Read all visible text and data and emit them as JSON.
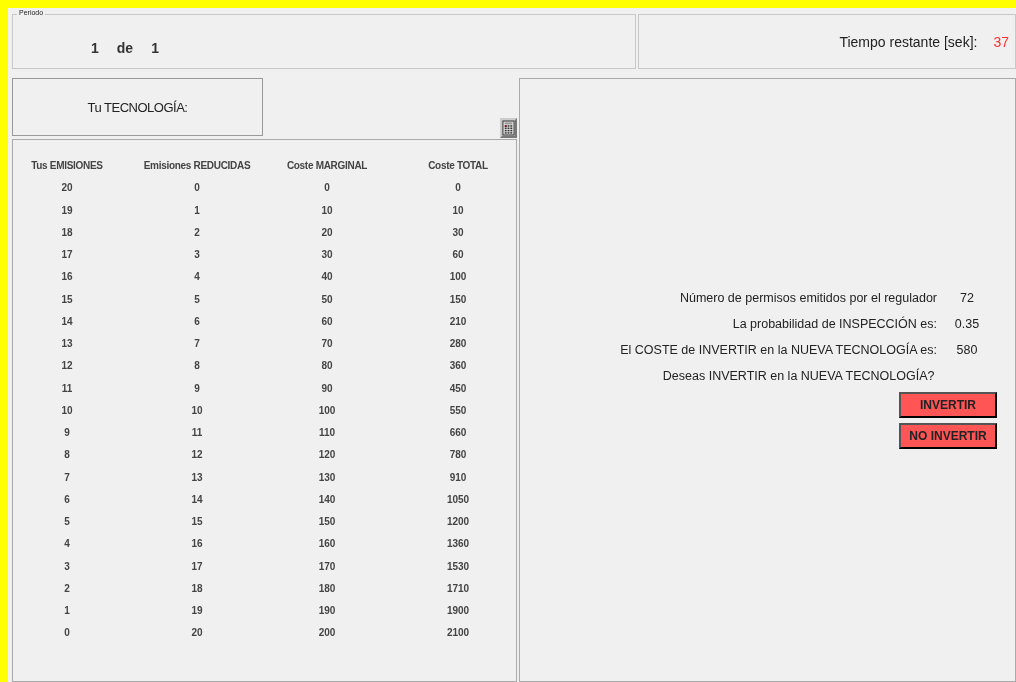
{
  "period": {
    "legend": "Periodo",
    "current": "1",
    "separator": "de",
    "total": "1"
  },
  "timer": {
    "label": "Tiempo restante [sek]:",
    "value": "37"
  },
  "technology": {
    "label": "Tu TECNOLOGÍA:"
  },
  "table": {
    "columns": [
      "Tus EMISIONES",
      "Emisiones REDUCIDAS",
      "Coste MARGINAL",
      "Coste TOTAL"
    ],
    "rows": [
      [
        "20",
        "0",
        "0",
        "0"
      ],
      [
        "19",
        "1",
        "10",
        "10"
      ],
      [
        "18",
        "2",
        "20",
        "30"
      ],
      [
        "17",
        "3",
        "30",
        "60"
      ],
      [
        "16",
        "4",
        "40",
        "100"
      ],
      [
        "15",
        "5",
        "50",
        "150"
      ],
      [
        "14",
        "6",
        "60",
        "210"
      ],
      [
        "13",
        "7",
        "70",
        "280"
      ],
      [
        "12",
        "8",
        "80",
        "360"
      ],
      [
        "11",
        "9",
        "90",
        "450"
      ],
      [
        "10",
        "10",
        "100",
        "550"
      ],
      [
        "9",
        "11",
        "110",
        "660"
      ],
      [
        "8",
        "12",
        "120",
        "780"
      ],
      [
        "7",
        "13",
        "130",
        "910"
      ],
      [
        "6",
        "14",
        "140",
        "1050"
      ],
      [
        "5",
        "15",
        "150",
        "1200"
      ],
      [
        "4",
        "16",
        "160",
        "1360"
      ],
      [
        "3",
        "17",
        "170",
        "1530"
      ],
      [
        "2",
        "18",
        "180",
        "1710"
      ],
      [
        "1",
        "19",
        "190",
        "1900"
      ],
      [
        "0",
        "20",
        "200",
        "2100"
      ]
    ]
  },
  "info": [
    {
      "label": "Número de permisos emitidos por el regulador",
      "value": "72"
    },
    {
      "label": "La probabilidad de INSPECCIÓN es:",
      "value": "0.35"
    },
    {
      "label": "El COSTE de INVERTIR en la NUEVA TECNOLOGÍA es:",
      "value": "580"
    }
  ],
  "question": "Deseas INVERTIR en la NUEVA TECNOLOGÍA?",
  "buttons": [
    "INVERTIR",
    "NO INVERTIR"
  ]
}
